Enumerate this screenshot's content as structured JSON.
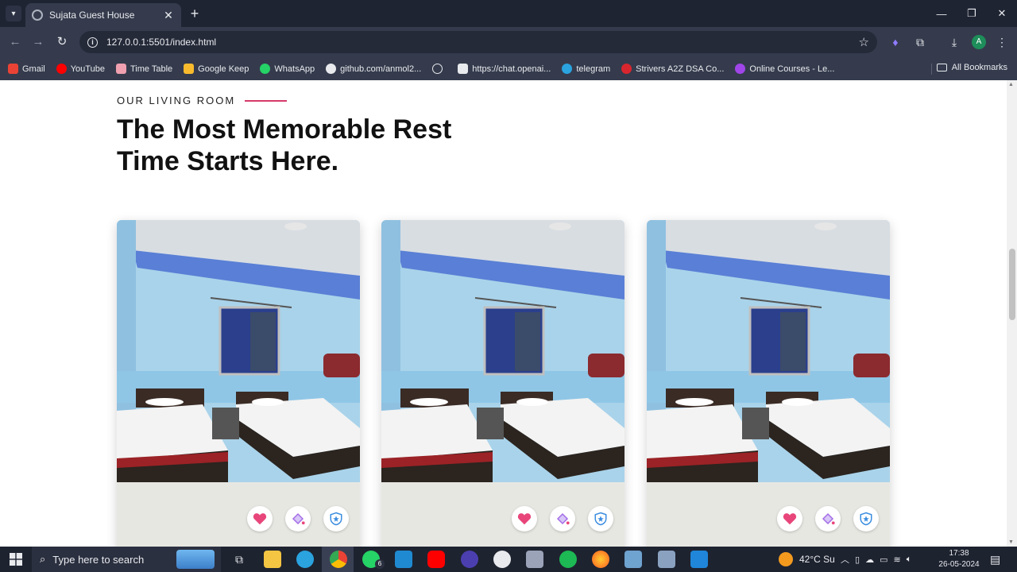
{
  "browser": {
    "tab_title": "Sujata Guest House",
    "url": "127.0.0.1:5501/index.html",
    "profile_initial": "A",
    "bookmarks": [
      {
        "label": "Gmail",
        "icon": "gmail-icon",
        "color": "#ea4335"
      },
      {
        "label": "YouTube",
        "icon": "youtube-icon",
        "color": "#ff0000"
      },
      {
        "label": "Time Table",
        "icon": "calendar-icon",
        "color": "#f0a0b0"
      },
      {
        "label": "Google Keep",
        "icon": "keep-icon",
        "color": "#f9bb2d"
      },
      {
        "label": "WhatsApp",
        "icon": "whatsapp-icon",
        "color": "#25d366"
      },
      {
        "label": "github.com/anmol2...",
        "icon": "github-icon",
        "color": "#e8eaed"
      },
      {
        "label": "",
        "icon": "globe-icon",
        "color": "#e8eaed"
      },
      {
        "label": "https://chat.openai...",
        "icon": "openai-icon",
        "color": "#e8eaed"
      },
      {
        "label": "telegram",
        "icon": "telegram-icon",
        "color": "#2aa3df"
      },
      {
        "label": "Strivers A2Z DSA Co...",
        "icon": "striver-icon",
        "color": "#d9262e"
      },
      {
        "label": "Online Courses - Le...",
        "icon": "courses-icon",
        "color": "#a046e8"
      }
    ],
    "all_bookmarks": "All Bookmarks"
  },
  "page": {
    "eyebrow": "OUR LIVING ROOM",
    "accent_color": "#d63a6b",
    "heading_line1": "The Most Memorable Rest",
    "heading_line2": "Time Starts Here.",
    "cards": [
      {
        "image": "room-photo",
        "actions": [
          "heart-icon",
          "paint-bucket-icon",
          "shield-star-icon"
        ]
      },
      {
        "image": "room-photo",
        "actions": [
          "heart-icon",
          "paint-bucket-icon",
          "shield-star-icon"
        ]
      },
      {
        "image": "room-photo",
        "actions": [
          "heart-icon",
          "paint-bucket-icon",
          "shield-star-icon"
        ]
      }
    ]
  },
  "taskbar": {
    "search_placeholder": "Type here to search",
    "whatsapp_badge": "6",
    "weather": "42°C  Su",
    "time": "17:38",
    "date": "26-05-2024"
  }
}
